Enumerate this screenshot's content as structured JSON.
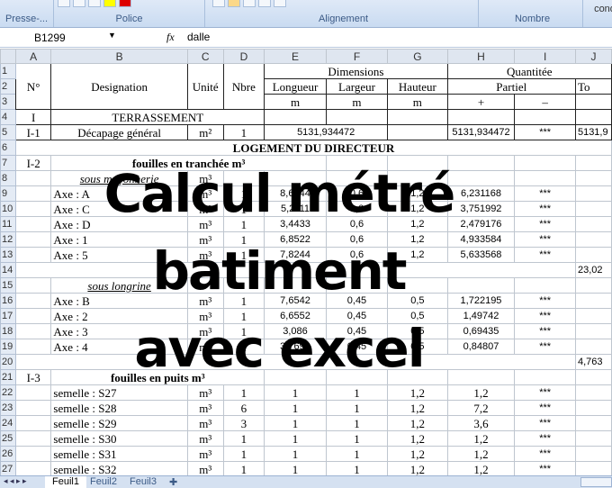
{
  "ribbon": {
    "groups": [
      "Presse-...",
      "Police",
      "Alignement",
      "Nombre",
      "cond"
    ]
  },
  "formula_bar": {
    "name_box": "B1299",
    "fx": "fx",
    "value": "dalle"
  },
  "columns": [
    "A",
    "B",
    "C",
    "D",
    "E",
    "F",
    "G",
    "H",
    "I",
    "J"
  ],
  "rows": [
    {
      "n": "1",
      "c": [
        {
          "t": "N°",
          "rs": 3
        },
        {
          "t": "Designation",
          "rs": 3
        },
        {
          "t": "Unité",
          "rs": 3
        },
        {
          "t": "Nbre",
          "rs": 3
        },
        {
          "t": "Dimensions",
          "cs": 3
        },
        {
          "t": "Quantitée",
          "cs": 3
        }
      ]
    },
    {
      "n": "2",
      "c": [
        {
          "t": "Longueur"
        },
        {
          "t": "Largeur"
        },
        {
          "t": "Hauteur"
        },
        {
          "t": "Partiel",
          "cs": 2
        },
        {
          "t": "To",
          "L": 1
        }
      ]
    },
    {
      "n": "3",
      "c": [
        {
          "t": "m"
        },
        {
          "t": "m"
        },
        {
          "t": "m"
        },
        {
          "t": "+"
        },
        {
          "t": "–"
        },
        {
          "t": ""
        }
      ]
    },
    {
      "n": "4",
      "c": [
        {
          "t": "I"
        },
        {
          "t": "TERRASSEMENT",
          "cs": 3
        },
        {
          "t": ""
        },
        {
          "t": ""
        },
        {
          "t": ""
        },
        {
          "t": ""
        },
        {
          "t": ""
        },
        {
          "t": ""
        }
      ]
    },
    {
      "n": "5",
      "c": [
        {
          "t": "I-1"
        },
        {
          "t": "Décapage général"
        },
        {
          "t": "m²"
        },
        {
          "t": "1"
        },
        {
          "t": "5131,934472",
          "cs": 2,
          "n": 1
        },
        {
          "t": ""
        },
        {
          "t": "5131,934472",
          "n": 1
        },
        {
          "t": "***",
          "n": 1
        },
        {
          "t": "5131,9",
          "n": 1,
          "L": 1
        }
      ]
    },
    {
      "n": "6",
      "c": [
        {
          "t": "LOGEMENT DU DIRECTEUR",
          "cs": 10,
          "b": 1
        }
      ]
    },
    {
      "n": "7",
      "c": [
        {
          "t": "I-2"
        },
        {
          "t": "fouilles en tranchée   m³",
          "cs": 4,
          "b": 1
        },
        {
          "t": ""
        },
        {
          "t": ""
        },
        {
          "t": ""
        },
        {
          "t": ""
        },
        {
          "t": ""
        }
      ]
    },
    {
      "n": "8",
      "c": [
        {
          "t": ""
        },
        {
          "t": "sous maçonnerie",
          "u": 1
        },
        {
          "t": "m³"
        },
        {
          "t": ""
        },
        {
          "t": ""
        },
        {
          "t": ""
        },
        {
          "t": ""
        },
        {
          "t": ""
        },
        {
          "t": ""
        },
        {
          "t": ""
        }
      ]
    },
    {
      "n": "9",
      "c": [
        {
          "t": ""
        },
        {
          "t": "Axe : A",
          "L": 1
        },
        {
          "t": "m³"
        },
        {
          "t": "1"
        },
        {
          "t": "8,6544",
          "n": 1
        },
        {
          "t": "0,6",
          "n": 1
        },
        {
          "t": "1,2",
          "n": 1
        },
        {
          "t": "6,231168",
          "n": 1
        },
        {
          "t": "***",
          "n": 1
        },
        {
          "t": ""
        }
      ]
    },
    {
      "n": "10",
      "c": [
        {
          "t": ""
        },
        {
          "t": "Axe : C",
          "L": 1
        },
        {
          "t": "m³"
        },
        {
          "t": "1"
        },
        {
          "t": "5,2111",
          "n": 1
        },
        {
          "t": "0,6",
          "n": 1
        },
        {
          "t": "1,2",
          "n": 1
        },
        {
          "t": "3,751992",
          "n": 1
        },
        {
          "t": "***",
          "n": 1
        },
        {
          "t": ""
        }
      ]
    },
    {
      "n": "11",
      "c": [
        {
          "t": ""
        },
        {
          "t": "Axe : D",
          "L": 1
        },
        {
          "t": "m³"
        },
        {
          "t": "1"
        },
        {
          "t": "3,4433",
          "n": 1
        },
        {
          "t": "0,6",
          "n": 1
        },
        {
          "t": "1,2",
          "n": 1
        },
        {
          "t": "2,479176",
          "n": 1
        },
        {
          "t": "***",
          "n": 1
        },
        {
          "t": ""
        }
      ]
    },
    {
      "n": "12",
      "c": [
        {
          "t": ""
        },
        {
          "t": "Axe : 1",
          "L": 1
        },
        {
          "t": "m³"
        },
        {
          "t": "1"
        },
        {
          "t": "6,8522",
          "n": 1
        },
        {
          "t": "0,6",
          "n": 1
        },
        {
          "t": "1,2",
          "n": 1
        },
        {
          "t": "4,933584",
          "n": 1
        },
        {
          "t": "***",
          "n": 1
        },
        {
          "t": ""
        }
      ]
    },
    {
      "n": "13",
      "c": [
        {
          "t": ""
        },
        {
          "t": "Axe : 5",
          "L": 1
        },
        {
          "t": "m³"
        },
        {
          "t": "1"
        },
        {
          "t": "7,8244",
          "n": 1
        },
        {
          "t": "0,6",
          "n": 1
        },
        {
          "t": "1,2",
          "n": 1
        },
        {
          "t": "5,633568",
          "n": 1
        },
        {
          "t": "***",
          "n": 1
        },
        {
          "t": ""
        }
      ]
    },
    {
      "n": "14",
      "c": [
        {
          "t": "",
          "cs": 9
        },
        {
          "t": "23,02",
          "n": 1,
          "L": 1
        }
      ]
    },
    {
      "n": "15",
      "c": [
        {
          "t": ""
        },
        {
          "t": "sous longrine",
          "u": 1
        },
        {
          "t": ""
        },
        {
          "t": ""
        },
        {
          "t": ""
        },
        {
          "t": ""
        },
        {
          "t": ""
        },
        {
          "t": ""
        },
        {
          "t": ""
        },
        {
          "t": ""
        }
      ]
    },
    {
      "n": "16",
      "c": [
        {
          "t": ""
        },
        {
          "t": "Axe : B",
          "L": 1
        },
        {
          "t": "m³"
        },
        {
          "t": "1"
        },
        {
          "t": "7,6542",
          "n": 1
        },
        {
          "t": "0,45",
          "n": 1
        },
        {
          "t": "0,5",
          "n": 1
        },
        {
          "t": "1,722195",
          "n": 1
        },
        {
          "t": "***",
          "n": 1
        },
        {
          "t": ""
        }
      ]
    },
    {
      "n": "17",
      "c": [
        {
          "t": ""
        },
        {
          "t": "Axe : 2",
          "L": 1
        },
        {
          "t": "m³"
        },
        {
          "t": "1"
        },
        {
          "t": "6,6552",
          "n": 1
        },
        {
          "t": "0,45",
          "n": 1
        },
        {
          "t": "0,5",
          "n": 1
        },
        {
          "t": "1,49742",
          "n": 1
        },
        {
          "t": "***",
          "n": 1
        },
        {
          "t": ""
        }
      ]
    },
    {
      "n": "18",
      "c": [
        {
          "t": ""
        },
        {
          "t": "Axe : 3",
          "L": 1
        },
        {
          "t": "m³"
        },
        {
          "t": "1"
        },
        {
          "t": "3,086",
          "n": 1
        },
        {
          "t": "0,45",
          "n": 1
        },
        {
          "t": "0,5",
          "n": 1
        },
        {
          "t": "0,69435",
          "n": 1
        },
        {
          "t": "***",
          "n": 1
        },
        {
          "t": ""
        }
      ]
    },
    {
      "n": "19",
      "c": [
        {
          "t": ""
        },
        {
          "t": "Axe : 4",
          "L": 1
        },
        {
          "t": "m³"
        },
        {
          "t": "1"
        },
        {
          "t": "3,7692",
          "n": 1
        },
        {
          "t": "0,45",
          "n": 1
        },
        {
          "t": "0,5",
          "n": 1
        },
        {
          "t": "0,84807",
          "n": 1
        },
        {
          "t": "***",
          "n": 1
        },
        {
          "t": ""
        }
      ]
    },
    {
      "n": "20",
      "c": [
        {
          "t": "",
          "cs": 9
        },
        {
          "t": "4,763",
          "n": 1,
          "L": 1
        }
      ]
    },
    {
      "n": "21",
      "c": [
        {
          "t": "I-3"
        },
        {
          "t": "fouilles en puits   m³",
          "cs": 3,
          "b": 1
        },
        {
          "t": ""
        },
        {
          "t": ""
        },
        {
          "t": ""
        },
        {
          "t": ""
        },
        {
          "t": ""
        },
        {
          "t": ""
        }
      ]
    },
    {
      "n": "22",
      "c": [
        {
          "t": ""
        },
        {
          "t": "semelle  : S27",
          "L": 1
        },
        {
          "t": "m³"
        },
        {
          "t": "1"
        },
        {
          "t": "1"
        },
        {
          "t": "1"
        },
        {
          "t": "1,2"
        },
        {
          "t": "1,2"
        },
        {
          "t": "***",
          "n": 1
        },
        {
          "t": ""
        }
      ]
    },
    {
      "n": "23",
      "c": [
        {
          "t": ""
        },
        {
          "t": "semelle  : S28",
          "L": 1
        },
        {
          "t": "m³"
        },
        {
          "t": "6"
        },
        {
          "t": "1"
        },
        {
          "t": "1"
        },
        {
          "t": "1,2"
        },
        {
          "t": "7,2"
        },
        {
          "t": "***",
          "n": 1
        },
        {
          "t": ""
        }
      ]
    },
    {
      "n": "24",
      "c": [
        {
          "t": ""
        },
        {
          "t": "semelle  : S29",
          "L": 1
        },
        {
          "t": "m³"
        },
        {
          "t": "3"
        },
        {
          "t": "1"
        },
        {
          "t": "1"
        },
        {
          "t": "1,2"
        },
        {
          "t": "3,6"
        },
        {
          "t": "***",
          "n": 1
        },
        {
          "t": ""
        }
      ]
    },
    {
      "n": "25",
      "c": [
        {
          "t": ""
        },
        {
          "t": "semelle  : S30",
          "L": 1
        },
        {
          "t": "m³"
        },
        {
          "t": "1"
        },
        {
          "t": "1"
        },
        {
          "t": "1"
        },
        {
          "t": "1,2"
        },
        {
          "t": "1,2"
        },
        {
          "t": "***",
          "n": 1
        },
        {
          "t": ""
        }
      ]
    },
    {
      "n": "26",
      "c": [
        {
          "t": ""
        },
        {
          "t": "semelle  : S31",
          "L": 1
        },
        {
          "t": "m³"
        },
        {
          "t": "1"
        },
        {
          "t": "1"
        },
        {
          "t": "1"
        },
        {
          "t": "1,2"
        },
        {
          "t": "1,2"
        },
        {
          "t": "***",
          "n": 1
        },
        {
          "t": ""
        }
      ]
    },
    {
      "n": "27",
      "c": [
        {
          "t": ""
        },
        {
          "t": "semelle  : S32",
          "L": 1
        },
        {
          "t": "m³"
        },
        {
          "t": "1"
        },
        {
          "t": "1"
        },
        {
          "t": "1"
        },
        {
          "t": "1,2"
        },
        {
          "t": "1,2"
        },
        {
          "t": "***",
          "n": 1
        },
        {
          "t": ""
        }
      ]
    }
  ],
  "overlay": {
    "line1": "Calcul métré",
    "line2": "batiment",
    "line3": "avec excel"
  },
  "sheets": [
    "Feuil1",
    "Feuil2",
    "Feuil3"
  ],
  "nav": "◂ ◂ ▸ ▸"
}
